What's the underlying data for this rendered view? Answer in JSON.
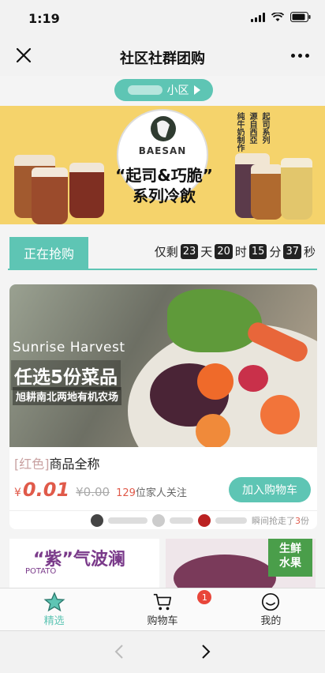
{
  "status": {
    "time": "1:19"
  },
  "nav": {
    "title": "社区社群团购"
  },
  "community": {
    "label": "小区"
  },
  "banner": {
    "brand": "BAESAN",
    "title_line1": "“起司&巧脆”",
    "title_line2": "系列冷飲",
    "side_text_1": "纯牛奶制作",
    "side_text_2": "源自西亞",
    "side_text_3": "起司系列"
  },
  "countdown": {
    "tab_label": "正在抢购",
    "prefix": "仅剩",
    "days": "23",
    "days_unit": "天",
    "hours": "20",
    "hours_unit": "时",
    "minutes": "15",
    "minutes_unit": "分",
    "seconds": "37",
    "seconds_unit": "秒"
  },
  "product": {
    "image_text_en": "Sunrise Harvest",
    "image_text_main": "任选5份菜品",
    "image_text_sub": "旭耕南北两地有机农场",
    "tag": "[红色]",
    "name": "商品全称",
    "currency": "¥",
    "price": "0.01",
    "old_price": "¥0.00",
    "followers_count": "129",
    "followers_text": "位家人关注",
    "add_to_cart": "加入购物车",
    "buyers_text": "瞬间抢走了",
    "buyers_count": "3",
    "buyers_unit": "份"
  },
  "mini_cards": {
    "left_title": "“紫”气波澜",
    "left_sub": "POTATO",
    "right_badge_1": "生鲜",
    "right_badge_2": "水果"
  },
  "tabbar": {
    "featured": "精选",
    "cart": "购物车",
    "cart_badge": "1",
    "mine": "我的"
  },
  "colors": {
    "accent": "#5ec5b4",
    "price": "#e05a4a",
    "badge": "#e8463a"
  }
}
